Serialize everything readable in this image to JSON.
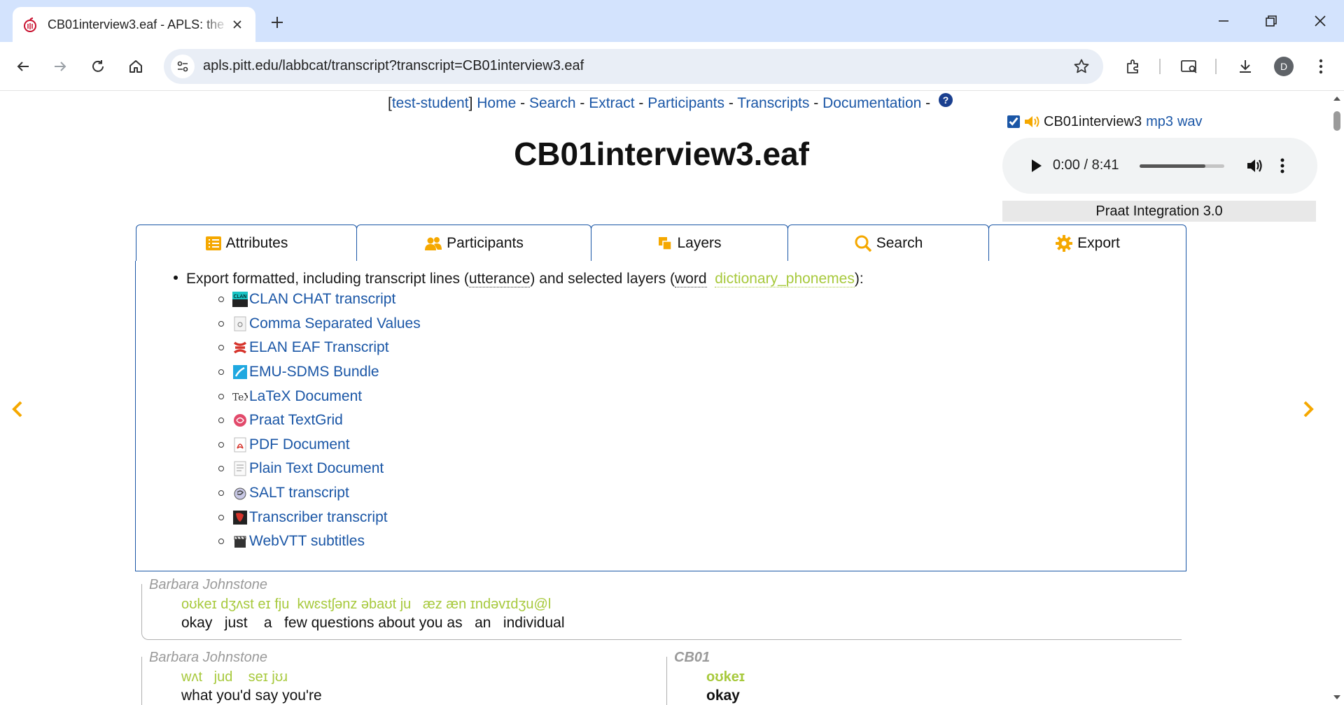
{
  "browser": {
    "tab_title": "CB01interview3.eaf - APLS: the ",
    "url": "apls.pitt.edu/labbcat/transcript?transcript=CB01interview3.eaf",
    "profile_initial": "D"
  },
  "nav": {
    "user": "test-student",
    "links": [
      "Home",
      "Search",
      "Extract",
      "Participants",
      "Transcripts",
      "Documentation"
    ],
    "help": "?"
  },
  "title": "CB01interview3.eaf",
  "media": {
    "name": "CB01interview3",
    "formats": [
      "mp3",
      "wav"
    ],
    "time": "0:00 / 8:41",
    "progress": 0.78,
    "praat": "Praat Integration 3.0"
  },
  "tabs": [
    {
      "label": "Attributes",
      "icon": "list-icon"
    },
    {
      "label": "Participants",
      "icon": "people-icon"
    },
    {
      "label": "Layers",
      "icon": "layers-icon"
    },
    {
      "label": "Search",
      "icon": "search-icon"
    },
    {
      "label": "Export",
      "icon": "gear-icon",
      "active": true
    }
  ],
  "export": {
    "intro_pre": "Export formatted, including transcript lines (",
    "utterance": "utterance",
    "mid": ") and selected layers (",
    "word": "word",
    "phonemes": "dictionary_phonemes",
    "end": "):",
    "formats": [
      {
        "label": "CLAN CHAT transcript",
        "icon": "clan-icon"
      },
      {
        "label": "Comma Separated Values",
        "icon": "csv-icon"
      },
      {
        "label": "ELAN EAF Transcript",
        "icon": "elan-icon"
      },
      {
        "label": "EMU-SDMS Bundle",
        "icon": "emu-icon"
      },
      {
        "label": "LaTeX Document",
        "icon": "tex-icon"
      },
      {
        "label": "Praat TextGrid",
        "icon": "praat-icon"
      },
      {
        "label": "PDF Document",
        "icon": "pdf-icon"
      },
      {
        "label": "Plain Text Document",
        "icon": "text-icon"
      },
      {
        "label": "SALT transcript",
        "icon": "salt-icon"
      },
      {
        "label": "Transcriber transcript",
        "icon": "transcriber-icon"
      },
      {
        "label": "WebVTT subtitles",
        "icon": "clapper-icon"
      }
    ]
  },
  "transcript": {
    "turn1": {
      "speaker": "Barbara Johnstone",
      "phonemes": "oʊkeɪ dʒʌst eɪ fju  kwɛstʃənz əbaʊt ju   æz æn ɪndəvɪdʒu@l",
      "words": "okay   just    a   few questions about you as   an   individual"
    },
    "turn2": {
      "speaker": "Barbara Johnstone",
      "phonemes": "wʌt   jud    seɪ jʊɹ",
      "words": "what you'd say you're"
    },
    "turn3": {
      "speaker": "CB01",
      "phonemes": "oʊkeɪ",
      "words": "okay"
    }
  },
  "colors": {
    "link": "#1a56a6",
    "accent_orange": "#f5a800",
    "phoneme_green": "#a7c93c",
    "chrome_tabbar": "#d3e3fd"
  }
}
